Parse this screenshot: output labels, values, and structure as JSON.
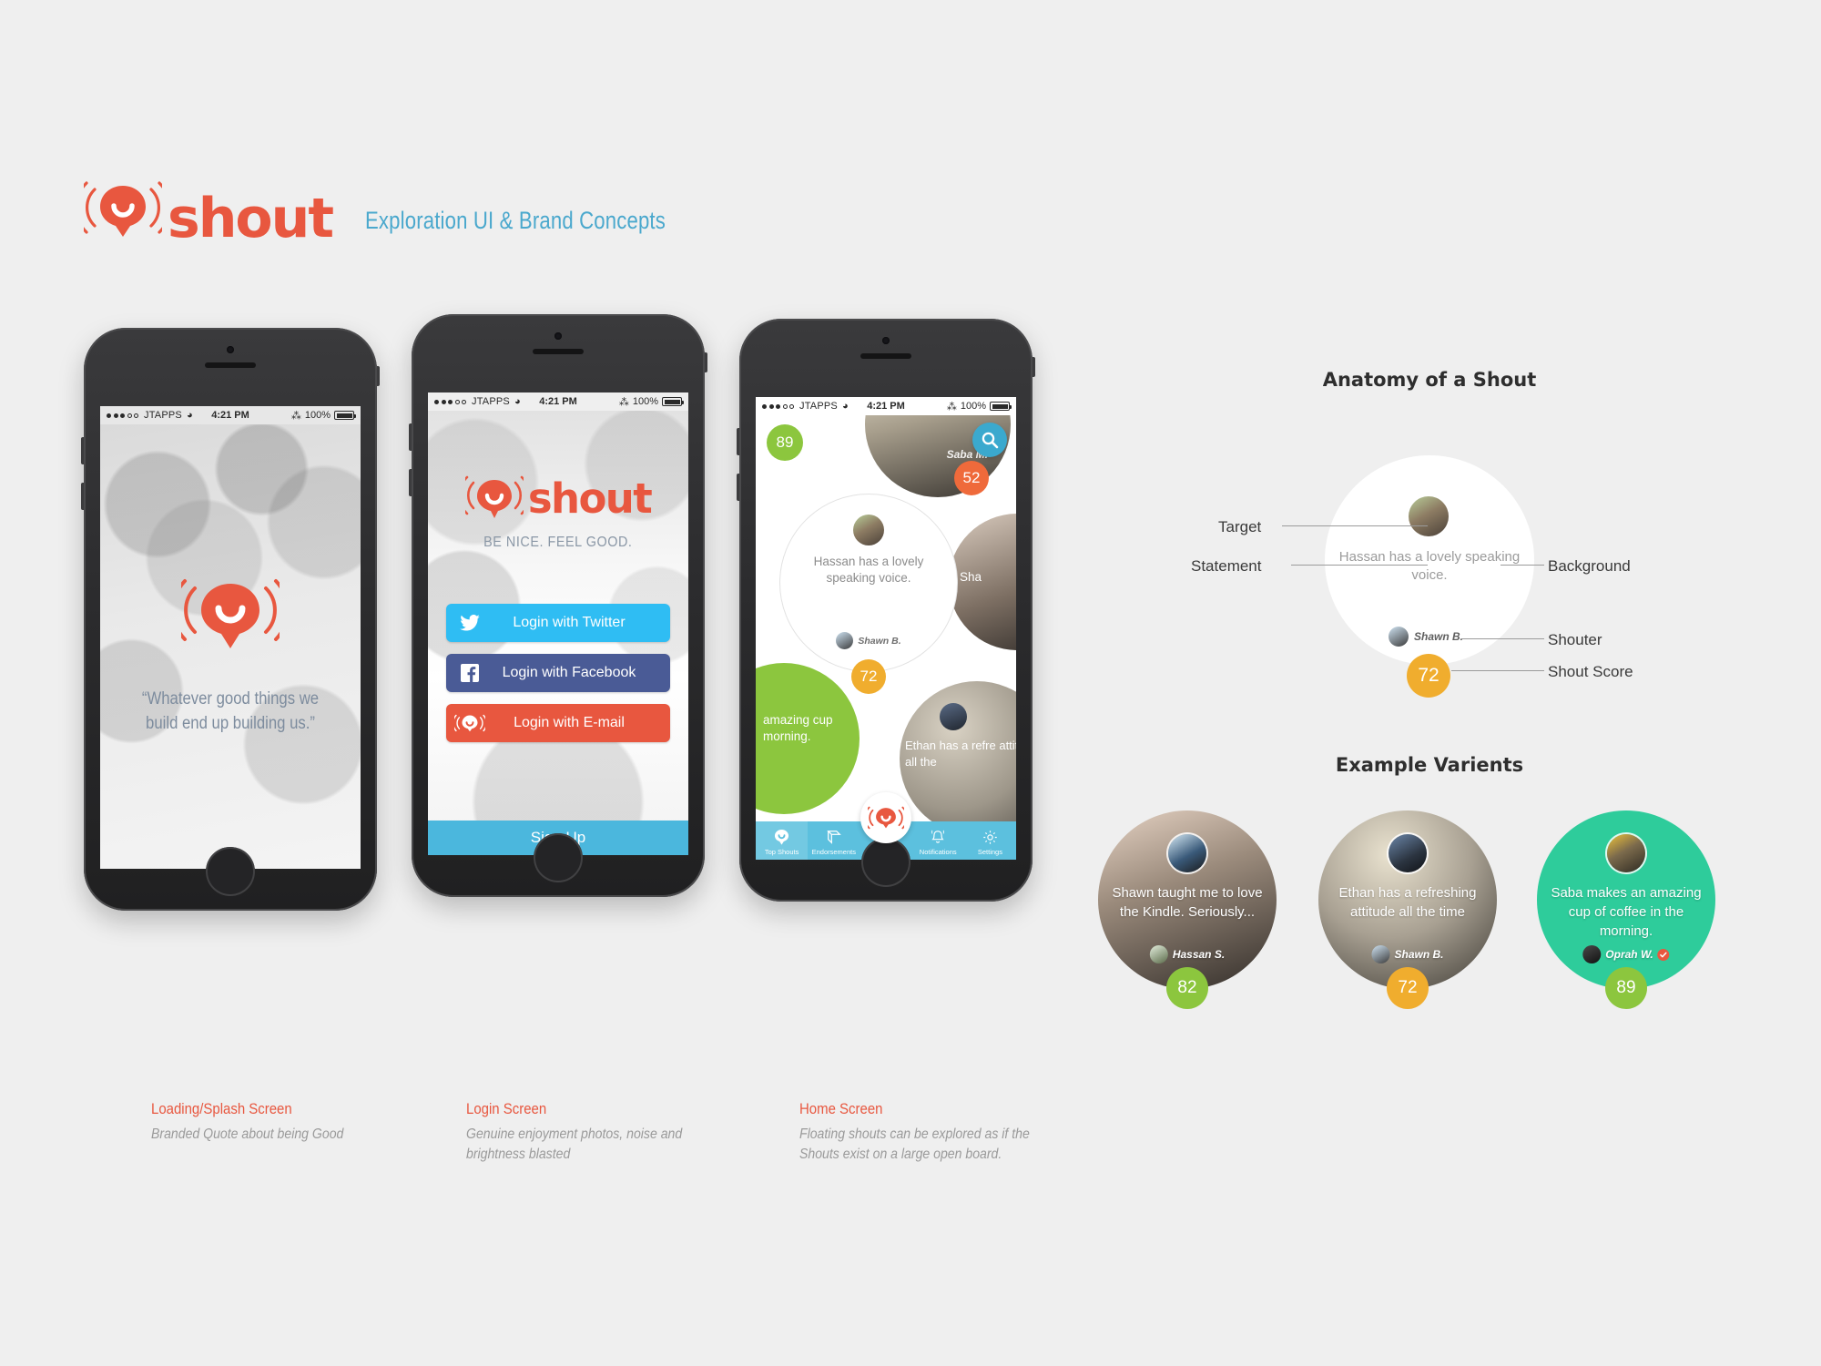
{
  "brand": {
    "logo_word": "shout",
    "subtitle": "Exploration UI & Brand Concepts",
    "accent_color": "#e8573f",
    "subtitle_color": "#4aa8cd"
  },
  "status_bar": {
    "carrier": "JTAPPS",
    "wifi_icon": "wifi-icon",
    "time": "4:21 PM",
    "bluetooth_icon": "bluetooth-icon",
    "battery_percent": "100%"
  },
  "screens": {
    "splash": {
      "quote": "“Whatever good things we build end up building us.”",
      "caption_title": "Loading/Splash Screen",
      "caption_desc": "Branded Quote about being Good"
    },
    "login": {
      "tagline": "BE NICE. FEEL GOOD.",
      "buttons": [
        {
          "label": "Login with Twitter",
          "icon": "twitter-icon",
          "color": "#2fbdf3"
        },
        {
          "label": "Login with Facebook",
          "icon": "facebook-icon",
          "color": "#4a5b96"
        },
        {
          "label": "Login with E-mail",
          "icon": "shout-icon",
          "color": "#e8573f"
        }
      ],
      "signup_label": "Sign Up",
      "caption_title": "Login Screen",
      "caption_desc": "Genuine enjoyment photos, noise and brightness blasted"
    },
    "home": {
      "search_icon": "search-icon",
      "shout_fab_icon": "shout-icon",
      "floating_scores": [
        {
          "value": "89",
          "color": "#8cc63e"
        },
        {
          "value": "52",
          "color": "#ef6a3b"
        }
      ],
      "main_shout": {
        "statement": "Hassan has a lovely speaking voice.",
        "shouter": "Shawn B.",
        "score": "72",
        "score_color": "#f0ad2e"
      },
      "partial_bubbles": [
        {
          "text": "Sha"
        },
        {
          "text": "amazing cup morning."
        },
        {
          "text": "Ethan has a refre attitude all the"
        }
      ],
      "tabs": [
        {
          "label": "Top Shouts",
          "icon": "shout-bubble-icon",
          "active": true
        },
        {
          "label": "Endorsements",
          "icon": "ribbon-icon",
          "active": false
        },
        {
          "label": "Notifications",
          "icon": "bell-icon",
          "active": false
        },
        {
          "label": "Settings",
          "icon": "gear-icon",
          "active": false
        }
      ],
      "caption_title": "Home Screen",
      "caption_desc": "Floating shouts can be explored as if the Shouts exist on a large open board."
    }
  },
  "anatomy": {
    "title": "Anatomy of a Shout",
    "labels": {
      "target": "Target",
      "statement": "Statement",
      "background": "Background",
      "shouter": "Shouter",
      "shout_score": "Shout Score"
    },
    "sample": {
      "statement": "Hassan has a lovely speaking voice.",
      "shouter": "Shawn B.",
      "score": "72",
      "score_color": "#f0ad2e"
    }
  },
  "variants": {
    "title": "Example Varients",
    "items": [
      {
        "statement": "Shawn taught me to love the Kindle. Seriously...",
        "shouter": "Hassan S.",
        "score": "82",
        "score_color": "#8cc63e",
        "verified": false
      },
      {
        "statement": "Ethan has a refreshing attitude all the time",
        "shouter": "Shawn B.",
        "score": "72",
        "score_color": "#f0ad2e",
        "verified": false
      },
      {
        "statement": "Saba makes an amazing cup of coffee in the morning.",
        "shouter": "Oprah W.",
        "score": "89",
        "score_color": "#8cc63e",
        "score_bg": "#2ecc9b",
        "verified": true
      }
    ]
  }
}
